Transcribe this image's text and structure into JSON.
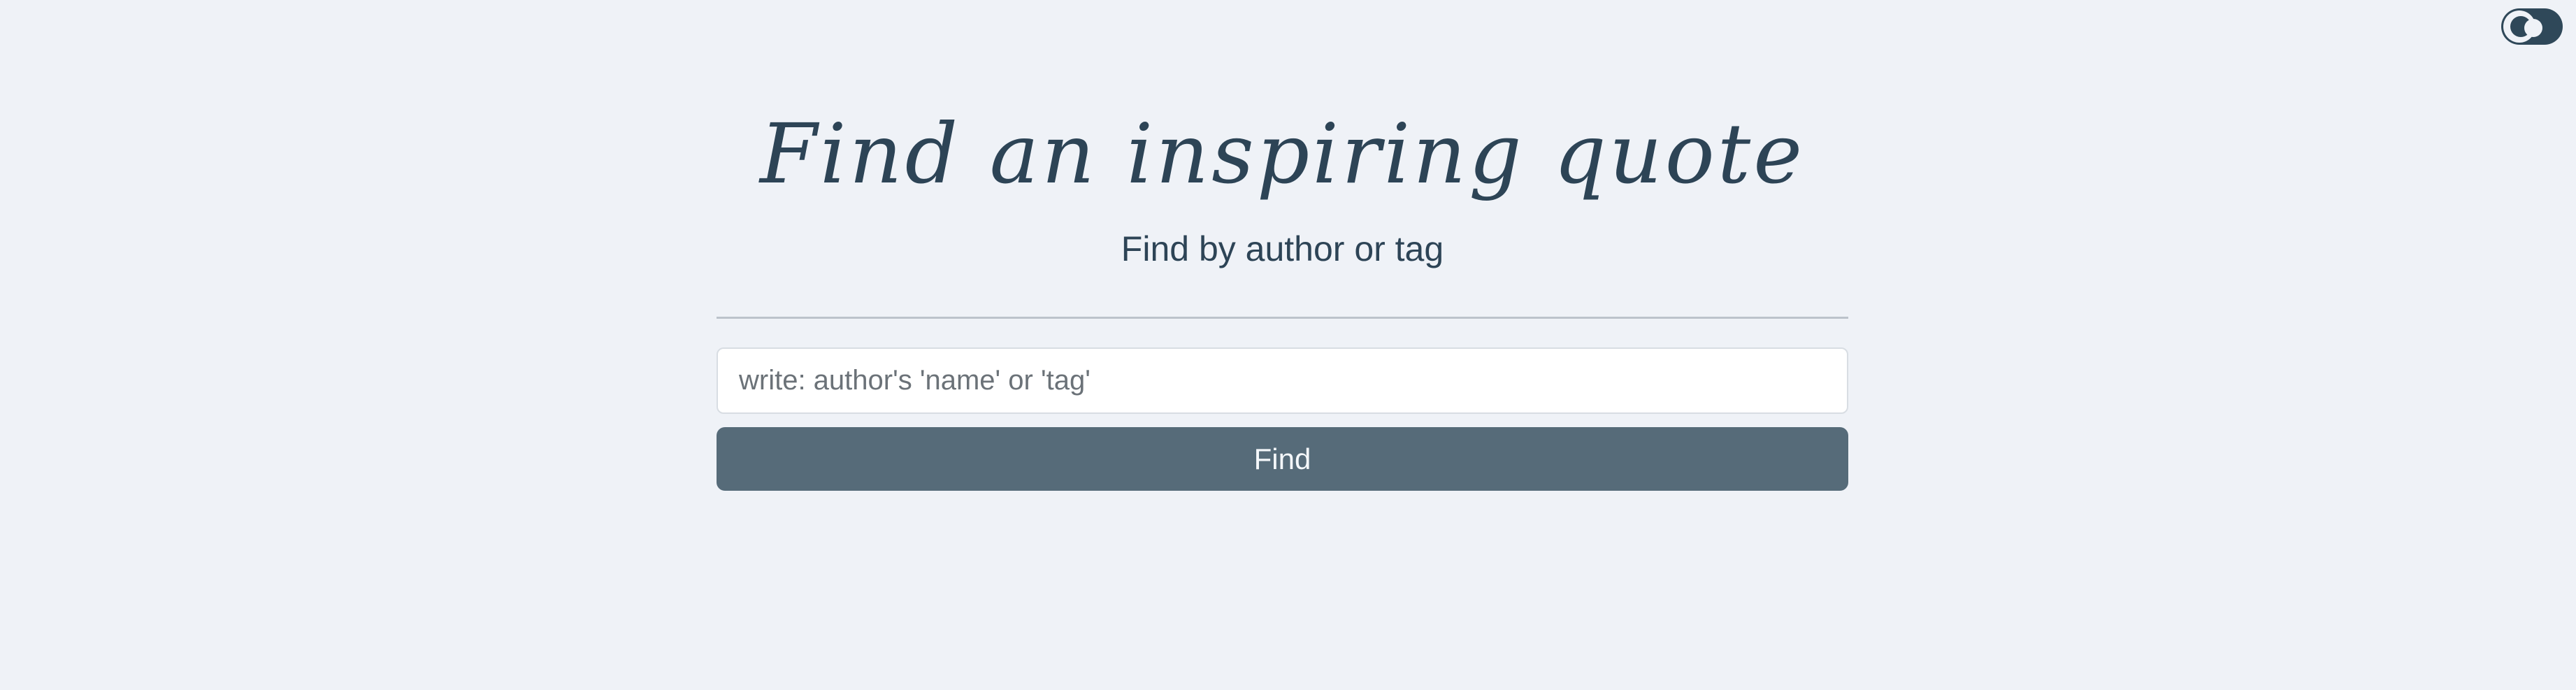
{
  "theme_toggle": {
    "icon": "moon-icon",
    "state": "on"
  },
  "header": {
    "title": "Find an inspiring quote",
    "subtitle": "Find by author or tag"
  },
  "search": {
    "placeholder": "write: author's 'name' or 'tag'",
    "value": ""
  },
  "actions": {
    "find_label": "Find"
  },
  "colors": {
    "background": "#eff2f7",
    "text": "#2d4456",
    "button": "#566b79",
    "toggle": "#2f4859"
  }
}
